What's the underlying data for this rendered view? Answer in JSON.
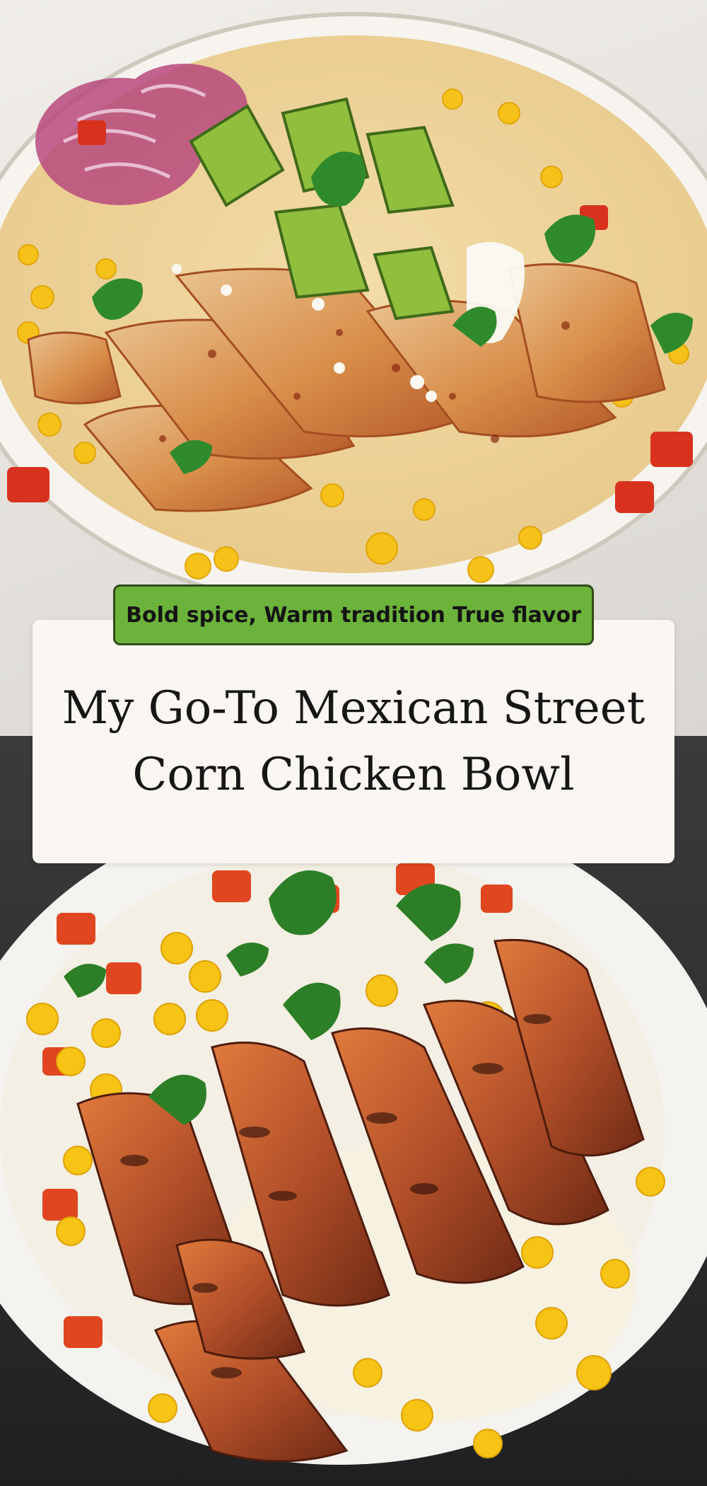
{
  "tagline": "Bold spice, Warm tradition True flavor",
  "title": "My Go-To Mexican Street Corn Chicken Bowl",
  "colors": {
    "tagline_bg": "#6cb33b",
    "tagline_border": "#2f4a1b",
    "card_bg": "#faf7f2",
    "title_text": "#161616"
  }
}
